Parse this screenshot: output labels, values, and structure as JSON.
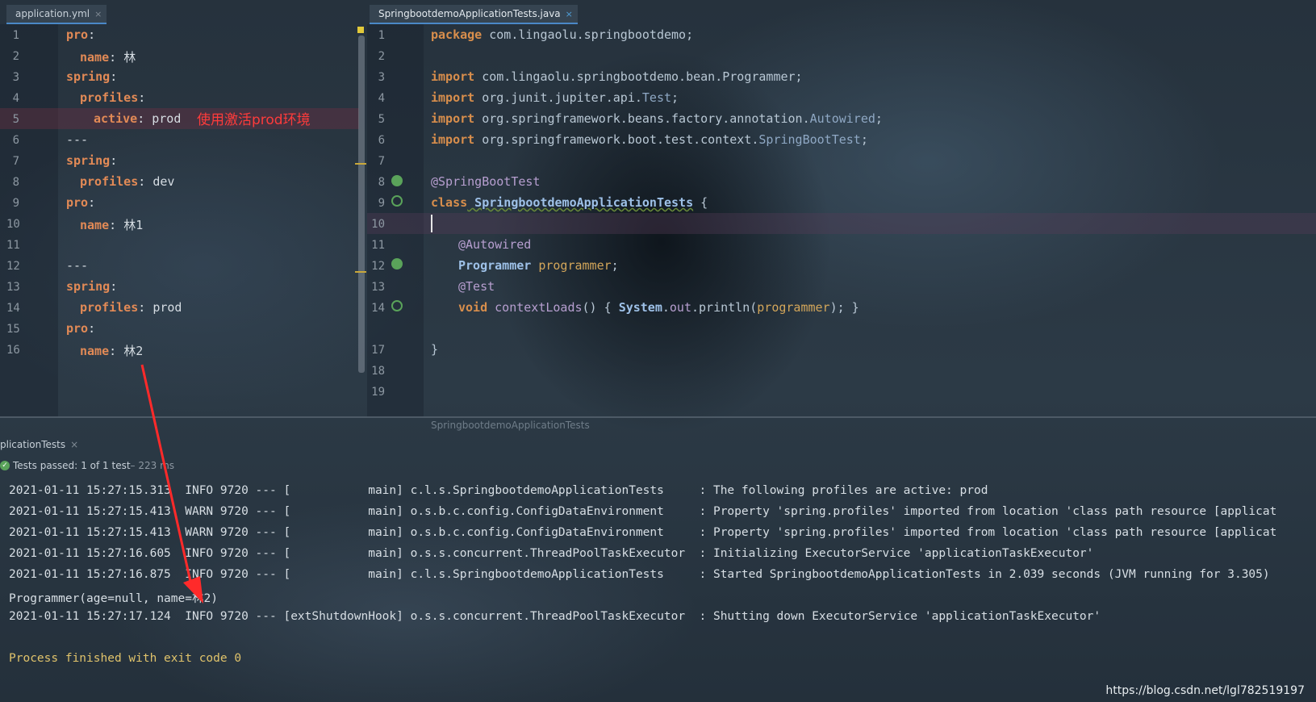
{
  "tabs": {
    "yml": {
      "label": "application.yml",
      "close": "×"
    },
    "java": {
      "label": "SpringbootdemoApplicationTests.java",
      "close": "×"
    }
  },
  "yaml": {
    "line_numbers": [
      "1",
      "2",
      "3",
      "4",
      "5",
      "6",
      "7",
      "8",
      "9",
      "10",
      "11",
      "12",
      "13",
      "14",
      "15",
      "16"
    ],
    "lines": [
      {
        "key": "pro",
        "sep": ":",
        "val": ""
      },
      {
        "key": "name",
        "sep": ": ",
        "val": "林"
      },
      {
        "key": "spring",
        "sep": ":",
        "val": ""
      },
      {
        "key": "profiles",
        "sep": ":",
        "val": ""
      },
      {
        "key": "active",
        "sep": ": ",
        "val": "prod"
      },
      {
        "key": "",
        "sep": "",
        "val": "---"
      },
      {
        "key": "spring",
        "sep": ":",
        "val": ""
      },
      {
        "key": "profiles",
        "sep": ": ",
        "val": "dev"
      },
      {
        "key": "pro",
        "sep": ":",
        "val": ""
      },
      {
        "key": "name",
        "sep": ": ",
        "val": "林1"
      },
      {
        "key": "",
        "sep": "",
        "val": ""
      },
      {
        "key": "",
        "sep": "",
        "val": "---"
      },
      {
        "key": "spring",
        "sep": ":",
        "val": ""
      },
      {
        "key": "profiles",
        "sep": ": ",
        "val": "prod"
      },
      {
        "key": "pro",
        "sep": ":",
        "val": ""
      },
      {
        "key": "name",
        "sep": ": ",
        "val": "林2"
      }
    ],
    "annotation": "使用激活prod环境"
  },
  "java": {
    "line_numbers": [
      "1",
      "2",
      "3",
      "4",
      "5",
      "6",
      "7",
      "8",
      "9",
      "10",
      "11",
      "12",
      "13",
      "14",
      "17",
      "18",
      "19"
    ],
    "l1": {
      "kw": "package",
      "rest": " com.lingaolu.springbootdemo;"
    },
    "l3": {
      "kw": "import",
      "pkg": " com.lingaolu.springbootdemo.bean.",
      "cls": "Programmer",
      "end": ";"
    },
    "l4": {
      "kw": "import",
      "pkg": " org.junit.jupiter.api.",
      "cls": "Test",
      "end": ";"
    },
    "l5": {
      "kw": "import",
      "pkg": " org.springframework.beans.factory.annotation.",
      "cls": "Autowired",
      "end": ";"
    },
    "l6": {
      "kw": "import",
      "pkg": " org.springframework.boot.test.context.",
      "cls": "SpringBootTest",
      "end": ";"
    },
    "l8": {
      "ann": "@SpringBootTest"
    },
    "l9": {
      "kw": "class",
      "name": " SpringbootdemoApplicationTests",
      "end": " {"
    },
    "l11": {
      "ann": "@Autowired"
    },
    "l12": {
      "type": "Programmer",
      "field": " programmer",
      "end": ";"
    },
    "l13": {
      "ann": "@Test"
    },
    "l14": {
      "kw": "void",
      "method": " contextLoads",
      "p1": "() { ",
      "sys": "System",
      "p2": ".",
      "out": "out",
      "p3": ".println(",
      "arg": "programmer",
      "p4": "); }"
    },
    "l18": {
      "text": "}"
    },
    "breadcrumb": "SpringbootdemoApplicationTests"
  },
  "console": {
    "tab_label": "plicationTests",
    "tab_close": "×",
    "status_passed": "Tests passed:",
    "status_count": "1 of 1 test",
    "status_time": " – 223 ms",
    "lines": [
      "2021-01-11 15:27:15.313  INFO 9720 --- [           main] c.l.s.SpringbootdemoApplicationTests     : The following profiles are active: prod",
      "2021-01-11 15:27:15.413  WARN 9720 --- [           main] o.s.b.c.config.ConfigDataEnvironment     : Property 'spring.profiles' imported from location 'class path resource [applicat",
      "2021-01-11 15:27:15.413  WARN 9720 --- [           main] o.s.b.c.config.ConfigDataEnvironment     : Property 'spring.profiles' imported from location 'class path resource [applicat",
      "2021-01-11 15:27:16.605  INFO 9720 --- [           main] o.s.s.concurrent.ThreadPoolTaskExecutor  : Initializing ExecutorService 'applicationTaskExecutor'",
      "2021-01-11 15:27:16.875  INFO 9720 --- [           main] c.l.s.SpringbootdemoApplicationTests     : Started SpringbootdemoApplicationTests in 2.039 seconds (JVM running for 3.305)",
      "Programmer(age=null, name=林2)",
      "2021-01-11 15:27:17.124  INFO 9720 --- [extShutdownHook] o.s.s.concurrent.ThreadPoolTaskExecutor  : Shutting down ExecutorService 'applicationTaskExecutor'",
      "",
      "Process finished with exit code 0"
    ]
  },
  "watermark": "https://blog.csdn.net/lgl782519197",
  "colors": {
    "keyword": "#d88e4c",
    "annotation_note": "#ff3b3b",
    "exit_line": "#e0c36b",
    "arrow": "#ff2a2a"
  }
}
